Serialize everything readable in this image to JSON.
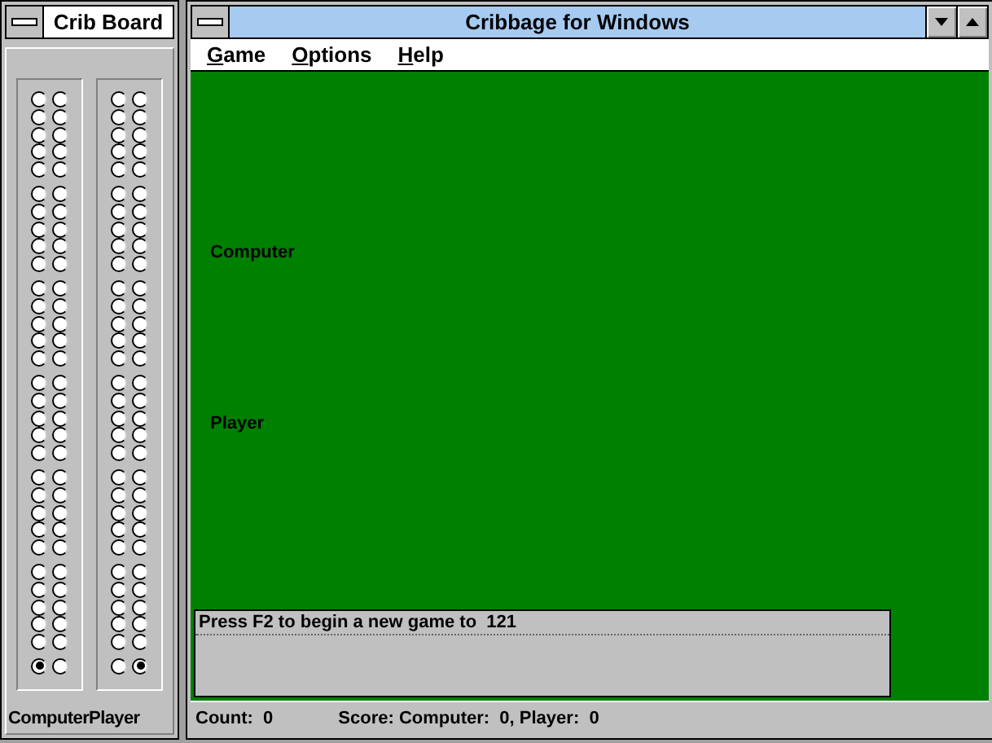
{
  "board_window": {
    "title": "Crib Board",
    "tracks": [
      {
        "label": "Computer",
        "columns": [
          {
            "start_peg": true
          },
          {
            "start_peg": false
          }
        ]
      },
      {
        "label": "Player",
        "columns": [
          {
            "start_peg": false
          },
          {
            "start_peg": true
          }
        ]
      }
    ]
  },
  "main_window": {
    "title": "Cribbage for Windows",
    "menu": [
      {
        "label": "Game"
      },
      {
        "label": "Options"
      },
      {
        "label": "Help"
      }
    ],
    "table_labels": [
      "Computer",
      "Player"
    ],
    "message": "Press F2 to begin a new game to  121",
    "status_bar": {
      "count": "Count:  0",
      "score": "Score: Computer:  0, Player:  0"
    }
  }
}
